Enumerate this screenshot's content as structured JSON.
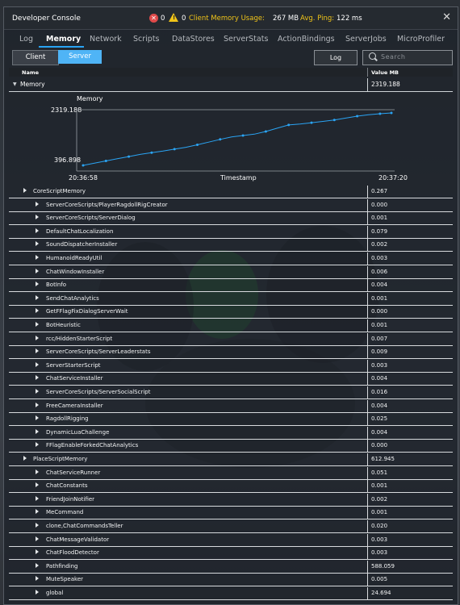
{
  "window": {
    "title": "Developer Console",
    "close_glyph": "✕"
  },
  "status": {
    "errors": "0",
    "warnings": "0",
    "memory_label": "Client Memory Usage:",
    "memory_value": "267 MB",
    "ping_label": "Avg. Ping:",
    "ping_value": "122 ms",
    "colors": {
      "error": "#e04a4a",
      "warning": "#f0c419",
      "label": "#f0c419"
    }
  },
  "tabs": [
    {
      "label": "Log"
    },
    {
      "label": "Memory"
    },
    {
      "label": "Network"
    },
    {
      "label": "Scripts"
    },
    {
      "label": "DataStores"
    },
    {
      "label": "ServerStats"
    },
    {
      "label": "ActionBindings"
    },
    {
      "label": "ServerJobs"
    },
    {
      "label": "MicroProfiler"
    }
  ],
  "mode": {
    "client": "Client",
    "server": "Server",
    "active": "Server"
  },
  "log_button": "Log",
  "search": {
    "placeholder": "Search",
    "icon": "search-icon"
  },
  "table": {
    "col_name": "Name",
    "col_value": "Value MB"
  },
  "memory_row": {
    "label": "Memory",
    "value": "2319.188"
  },
  "chart_data": {
    "type": "line",
    "title": "Memory",
    "xlabel": "Timestamp",
    "x_start": "20:36:58",
    "x_end": "20:37:20",
    "ylim": [
      396.898,
      2319.188
    ],
    "y_ticks": [
      "2319.188",
      "396.898"
    ],
    "color": "#2aa4f4",
    "series": [
      {
        "values": [
          396.9,
          480,
          560,
          640,
          720,
          800,
          860,
          920,
          990,
          1060,
          1150,
          1250,
          1350,
          1440,
          1490,
          1540,
          1640,
          1760,
          1880,
          1910,
          1960,
          2010,
          2060,
          2130,
          2200,
          2250,
          2290,
          2319.188
        ]
      }
    ]
  },
  "sections": [
    {
      "name": "CoreScriptMemory",
      "value": "0.267",
      "children": [
        {
          "name": "ServerCoreScripts/PlayerRagdollRigCreator",
          "value": "0.000"
        },
        {
          "name": "ServerCoreScripts/ServerDialog",
          "value": "0.001"
        },
        {
          "name": "DefaultChatLocalization",
          "value": "0.079"
        },
        {
          "name": "SoundDispatcherInstaller",
          "value": "0.002"
        },
        {
          "name": "HumanoidReadyUtil",
          "value": "0.003"
        },
        {
          "name": "ChatWindowInstaller",
          "value": "0.006"
        },
        {
          "name": "BotInfo",
          "value": "0.004"
        },
        {
          "name": "SendChatAnalytics",
          "value": "0.001"
        },
        {
          "name": "GetFFlagFixDialogServerWait",
          "value": "0.000"
        },
        {
          "name": "BotHeuristic",
          "value": "0.001"
        },
        {
          "name": "rcc/HiddenStarterScript",
          "value": "0.007"
        },
        {
          "name": "ServerCoreScripts/ServerLeaderstats",
          "value": "0.009"
        },
        {
          "name": "ServerStarterScript",
          "value": "0.003"
        },
        {
          "name": "ChatServiceInstaller",
          "value": "0.004"
        },
        {
          "name": "ServerCoreScripts/ServerSocialScript",
          "value": "0.016"
        },
        {
          "name": "FreeCameraInstaller",
          "value": "0.004"
        },
        {
          "name": "RagdollRigging",
          "value": "0.025"
        },
        {
          "name": "DynamicLuaChallenge",
          "value": "0.004"
        },
        {
          "name": "FFlagEnableForkedChatAnalytics",
          "value": "0.000"
        }
      ]
    },
    {
      "name": "PlaceScriptMemory",
      "value": "612.945",
      "children": [
        {
          "name": "ChatServiceRunner",
          "value": "0.051"
        },
        {
          "name": "ChatConstants",
          "value": "0.001"
        },
        {
          "name": "FriendJoinNotifier",
          "value": "0.002"
        },
        {
          "name": "MeCommand",
          "value": "0.001"
        },
        {
          "name": "clone,ChatCommandsTeller",
          "value": "0.020"
        },
        {
          "name": "ChatMessageValidator",
          "value": "0.003"
        },
        {
          "name": "ChatFloodDetector",
          "value": "0.003"
        },
        {
          "name": "Pathfinding",
          "value": "588.059"
        },
        {
          "name": "MuteSpeaker",
          "value": "0.005"
        },
        {
          "name": "global",
          "value": "24.694"
        }
      ]
    }
  ]
}
